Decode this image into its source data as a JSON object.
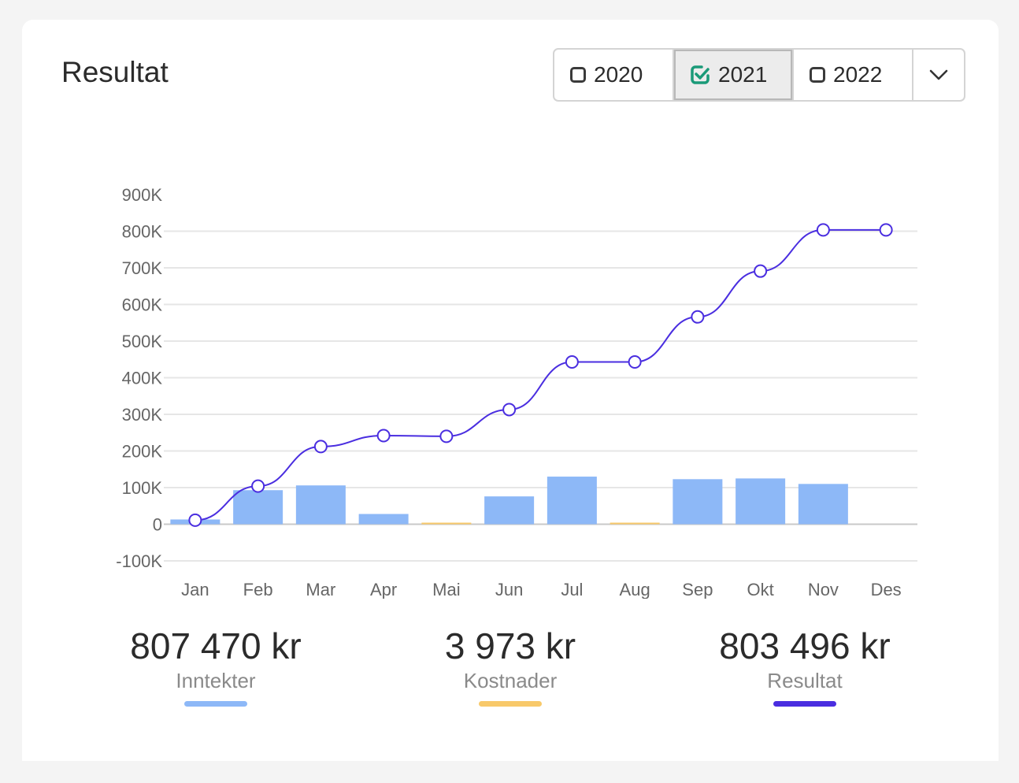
{
  "header": {
    "title": "Resultat"
  },
  "year_selector": {
    "options": [
      {
        "label": "2020",
        "checked": false
      },
      {
        "label": "2021",
        "checked": true
      },
      {
        "label": "2022",
        "checked": false
      }
    ]
  },
  "colors": {
    "inntekter": "#8db8f7",
    "kostnader": "#f8c96a",
    "resultat": "#4a2ee0",
    "check": "#1a9a78"
  },
  "chart_data": {
    "type": "bar",
    "categories": [
      "Jan",
      "Feb",
      "Mar",
      "Apr",
      "Mai",
      "Jun",
      "Jul",
      "Aug",
      "Sep",
      "Okt",
      "Nov",
      "Des"
    ],
    "ylim": [
      -100000,
      900000
    ],
    "yticks": [
      "-100K",
      "0",
      "100K",
      "200K",
      "300K",
      "400K",
      "500K",
      "600K",
      "700K",
      "800K",
      "900K"
    ],
    "ytick_values": [
      -100000,
      0,
      100000,
      200000,
      300000,
      400000,
      500000,
      600000,
      700000,
      800000,
      900000
    ],
    "series": [
      {
        "name": "Inntekter",
        "type": "bar",
        "values": [
          13000,
          93000,
          106000,
          28000,
          0,
          76000,
          130000,
          0,
          123000,
          125000,
          110000,
          0
        ]
      },
      {
        "name": "Kostnader",
        "type": "bar",
        "values": [
          0,
          0,
          0,
          0,
          3000,
          0,
          0,
          973,
          0,
          0,
          0,
          0
        ]
      },
      {
        "name": "Resultat",
        "type": "line",
        "values": [
          11000,
          104000,
          212000,
          242000,
          240000,
          313000,
          443000,
          443000,
          566000,
          691000,
          803496,
          803496
        ]
      }
    ]
  },
  "summary": [
    {
      "value": "807 470 kr",
      "label": "Inntekter"
    },
    {
      "value": "3 973 kr",
      "label": "Kostnader"
    },
    {
      "value": "803 496 kr",
      "label": "Resultat"
    }
  ]
}
